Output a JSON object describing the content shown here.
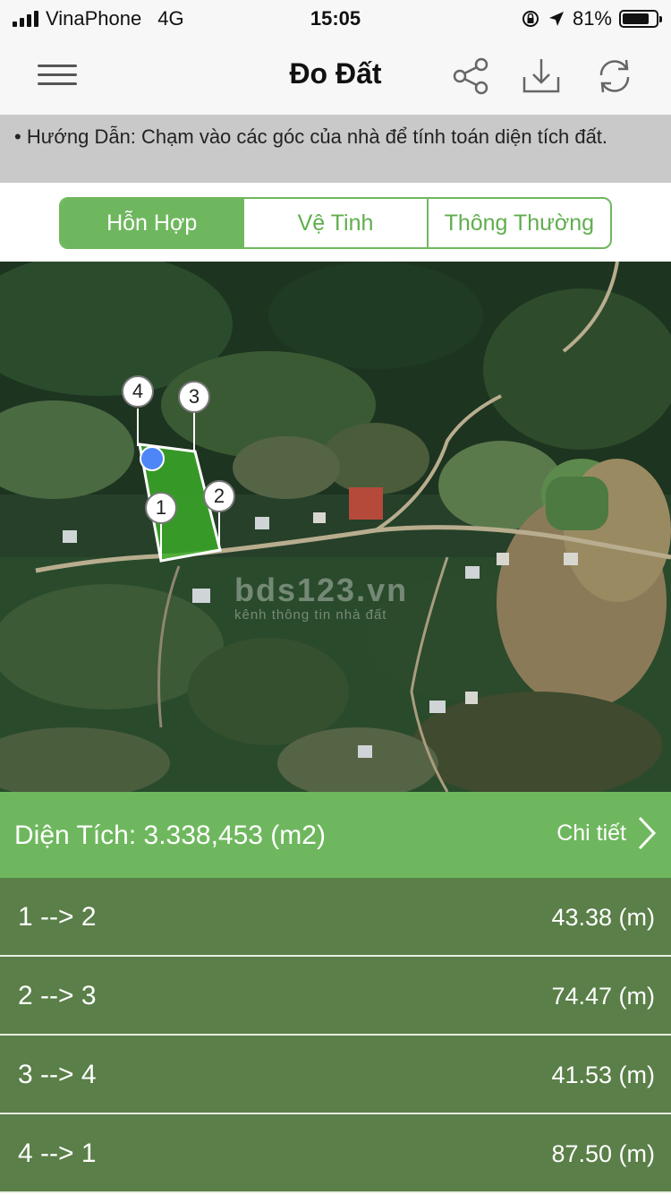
{
  "status_bar": {
    "carrier": "VinaPhone",
    "network": "4G",
    "time": "15:05",
    "battery": "81%",
    "battery_level": 0.81
  },
  "nav": {
    "title": "Đo Đất",
    "icons": [
      "menu-icon",
      "share-icon",
      "download-icon",
      "refresh-icon"
    ]
  },
  "instruction": "• Hướng Dẫn: Chạm vào các góc của nhà để tính toán diện tích đất.",
  "segments": [
    {
      "label": "Hỗn Hợp",
      "active": true
    },
    {
      "label": "Vệ Tinh",
      "active": false
    },
    {
      "label": "Thông Thường",
      "active": false
    }
  ],
  "map": {
    "markers": [
      "1",
      "2",
      "3",
      "4"
    ],
    "watermark": "bds123.vn",
    "watermark_sub": "kênh thông tin nhà đất"
  },
  "area": {
    "label": "Diện Tích: 3.338,453 (m2)",
    "detail": "Chi tiết"
  },
  "distances": [
    {
      "segment": "1 --> 2",
      "value": "43.38 (m)"
    },
    {
      "segment": "2 --> 3",
      "value": "74.47 (m)"
    },
    {
      "segment": "3 --> 4",
      "value": "41.53 (m)"
    },
    {
      "segment": "4 --> 1",
      "value": "87.50 (m)"
    }
  ],
  "colors": {
    "accent": "#6fb75e",
    "row_bg": "#5a7f48",
    "banner_bg": "#c9c9c9"
  }
}
